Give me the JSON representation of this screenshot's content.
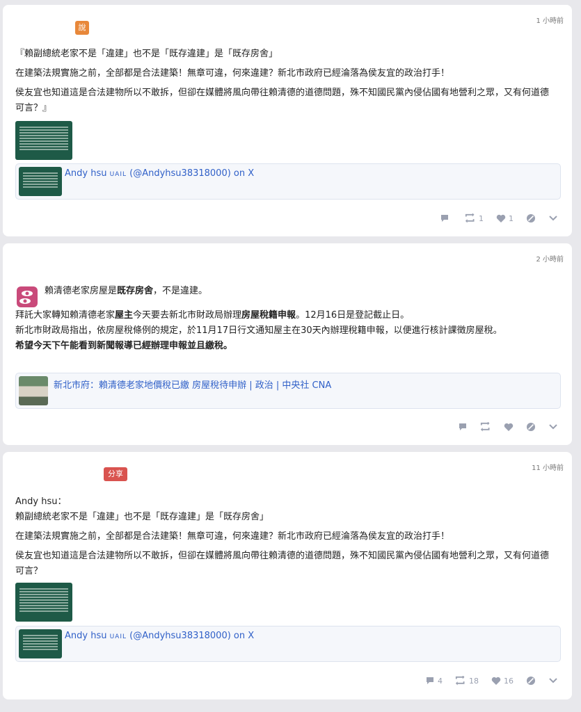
{
  "posts": [
    {
      "time": "1 小時前",
      "badge": "說",
      "badge_color": "#e8883a",
      "paragraphs": [
        "『賴副總統老家不是「違建」也不是「既存違建」是「既存房舍」",
        "在建築法規實施之前，全部都是合法建築！無章可違，何來違建？新北市政府已經淪落為侯友宜的政治打手！",
        "侯友宜也知道這是合法建物所以不敢拆，但卻在媒體將風向帶往賴清德的道德問題，殊不知國民黨內侵佔國有地營利之眾，又有何道德可言？』"
      ],
      "card": {
        "title_prefix": "Andy hsu ",
        "title_sc": "UAIL",
        "title_suffix": " (@Andyhsu38318000) on X"
      },
      "actions": {
        "replies": "",
        "boosts": "1",
        "favs": "1"
      }
    },
    {
      "time": "2 小時前",
      "title_pre": "賴清德老家房屋是",
      "title_bold": "既存房舍",
      "title_post": "，不是違建。",
      "line1_pre": "拜託大家轉知賴清德老家",
      "line1_b1": "屋主",
      "line1_mid": "今天要去新北市財政局辦理",
      "line1_b2": "房屋稅籍申報",
      "line1_post": "。12月16日是登記截止日。",
      "line2": "新北市財政局指出，依房屋稅條例的規定，於11月17日行文通知屋主在30天內辦理稅籍申報，以便進行核計課徵房屋稅。",
      "line3": "希望今天下午能看到新聞報導已經辦理申報並且繳稅。",
      "card_title": "新北市府：賴清德老家地價稅已繳 房屋稅待申辦 | 政治 | 中央社 CNA",
      "icon_color": "#c94a7a"
    },
    {
      "time": "11 小時前",
      "badge": "分享",
      "badge_color": "#d9534f",
      "author": "Andy hsu：",
      "paragraphs": [
        "賴副總統老家不是「違建」也不是「既存違建」是「既存房舍」",
        "在建築法規實施之前，全部都是合法建築！無章可違，何來違建？新北市政府已經淪落為侯友宜的政治打手！",
        "侯友宜也知道這是合法建物所以不敢拆，但卻在媒體將風向帶往賴清德的道德問題，殊不知國民黨內侵佔國有地營利之眾，又有何道德可言？"
      ],
      "card": {
        "title_prefix": "Andy hsu ",
        "title_sc": "UAIL",
        "title_suffix": " (@Andyhsu38318000) on X"
      },
      "actions": {
        "replies": "4",
        "boosts": "18",
        "favs": "16"
      }
    }
  ]
}
